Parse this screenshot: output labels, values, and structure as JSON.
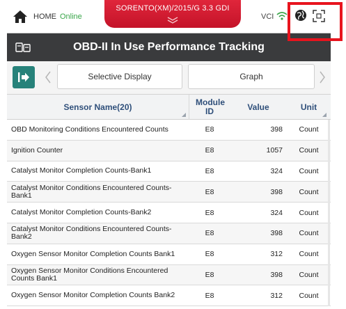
{
  "topbar": {
    "home_label": "HOME",
    "status": "Online",
    "vehicle": "SORENTO(XM)/2015/G 3.3 GDI",
    "vci_label": "VCI",
    "icons": [
      "home-icon",
      "chevron-down-icon",
      "wifi-icon",
      "globe-icon",
      "fullscreen-icon"
    ],
    "accent": "#d11a2e",
    "status_color": "#3aa64a"
  },
  "titlebar": {
    "title": "OBD-II In Use Performance Tracking"
  },
  "toolbar": {
    "selective_display": "Selective Display",
    "graph": "Graph"
  },
  "table": {
    "headers": {
      "sensor_name": "Sensor Name(20)",
      "module_id": "Module ID",
      "value": "Value",
      "unit": "Unit"
    },
    "rows": [
      {
        "name": "OBD Monitoring Conditions Encountered Counts",
        "module": "E8",
        "value": "398",
        "unit": "Count"
      },
      {
        "name": "Ignition Counter",
        "module": "E8",
        "value": "1057",
        "unit": "Count"
      },
      {
        "name": "Catalyst Monitor Completion Counts-Bank1",
        "module": "E8",
        "value": "324",
        "unit": "Count"
      },
      {
        "name": "Catalyst Monitor Conditions Encountered Counts-Bank1",
        "module": "E8",
        "value": "398",
        "unit": "Count"
      },
      {
        "name": "Catalyst Monitor Completion Counts-Bank2",
        "module": "E8",
        "value": "324",
        "unit": "Count"
      },
      {
        "name": "Catalyst Monitor Conditions Encountered Counts-Bank2",
        "module": "E8",
        "value": "398",
        "unit": "Count"
      },
      {
        "name": "Oxygen Sensor Monitor Completion Counts Bank1",
        "module": "E8",
        "value": "312",
        "unit": "Count"
      },
      {
        "name": "Oxygen Sensor Monitor Conditions Encountered Counts Bank1",
        "module": "E8",
        "value": "398",
        "unit": "Count"
      },
      {
        "name": "Oxygen Sensor Monitor Completion Counts Bank2",
        "module": "E8",
        "value": "312",
        "unit": "Count"
      }
    ]
  },
  "annotation": {
    "highlight_color": "#e8141e"
  }
}
